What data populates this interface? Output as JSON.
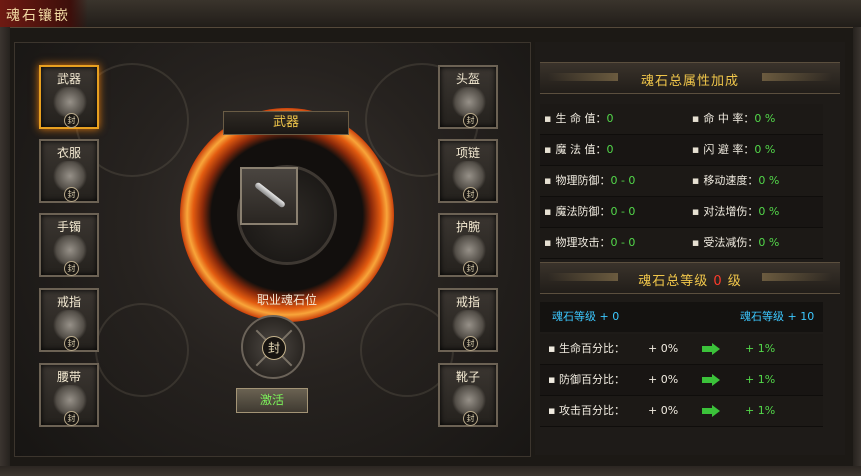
{
  "window": {
    "title": "魂石镶嵌"
  },
  "left_slots": [
    {
      "label": "武器",
      "seal": "封"
    },
    {
      "label": "衣服",
      "seal": "封"
    },
    {
      "label": "手镯",
      "seal": "封"
    },
    {
      "label": "戒指",
      "seal": "封"
    },
    {
      "label": "腰带",
      "seal": "封"
    }
  ],
  "right_slots": [
    {
      "label": "头盔",
      "seal": "封"
    },
    {
      "label": "项链",
      "seal": "封"
    },
    {
      "label": "护腕",
      "seal": "封"
    },
    {
      "label": "戒指",
      "seal": "封"
    },
    {
      "label": "靴子",
      "seal": "封"
    }
  ],
  "center": {
    "header": "武器",
    "job_label": "职业魂石位",
    "job_seal": "封",
    "activate_label": "激活"
  },
  "totals": {
    "header": "魂石总属性加成",
    "rows": [
      {
        "left_name": "生 命 值：",
        "left_value": "0",
        "right_name": "命 中 率：",
        "right_value": "0 %"
      },
      {
        "left_name": "魔 法 值：",
        "left_value": "0",
        "right_name": "闪 避 率：",
        "right_value": "0 %"
      },
      {
        "left_name": "物理防御：",
        "left_value": "0 - 0",
        "right_name": "移动速度：",
        "right_value": "0 %"
      },
      {
        "left_name": "魔法防御：",
        "left_value": "0 - 0",
        "right_name": "对法增伤：",
        "right_value": "0 %"
      },
      {
        "left_name": "物理攻击：",
        "left_value": "0 - 0",
        "right_name": "受法减伤：",
        "right_value": "0 %"
      }
    ]
  },
  "level": {
    "header_prefix": "魂石总等级",
    "value": "0",
    "header_suffix": "级",
    "current_label": "魂石等级 + 0",
    "next_label": "魂石等级 + 10",
    "rows": [
      {
        "name": "生命百分比：",
        "current": "+ 0%",
        "next": "+ 1%"
      },
      {
        "name": "防御百分比：",
        "current": "+ 0%",
        "next": "+ 1%"
      },
      {
        "name": "攻击百分比：",
        "current": "+ 0%",
        "next": "+ 1%"
      }
    ]
  },
  "colors": {
    "gold": "#f0c64a",
    "green": "#53d84a",
    "cyan": "#3cc8ff",
    "red": "#ff3b2b"
  }
}
